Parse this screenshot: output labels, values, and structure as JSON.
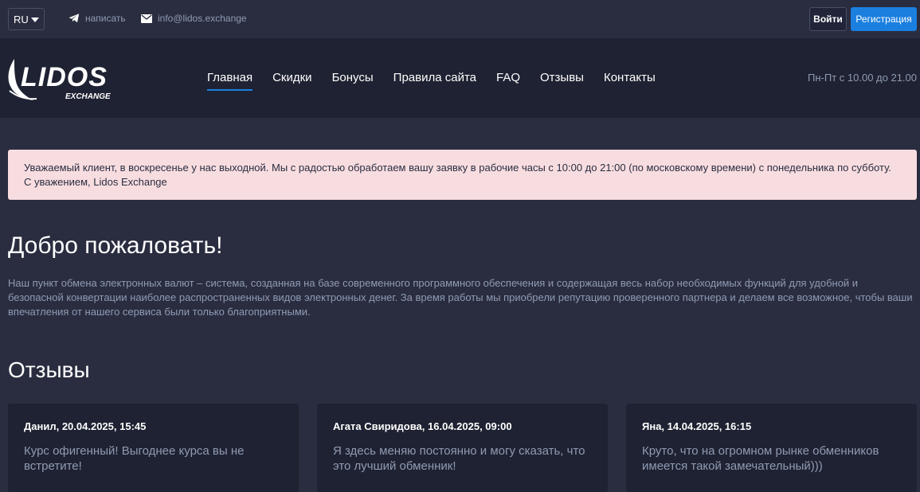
{
  "topbar": {
    "language": "RU",
    "telegram_label": "написать",
    "email_label": "info@lidos.exchange",
    "login_label": "Войти",
    "register_label": "Регистрация"
  },
  "header": {
    "logo_text": "LIDOS",
    "logo_subtext": "EXCHANGE",
    "nav": [
      {
        "label": "Главная",
        "active": true
      },
      {
        "label": "Скидки"
      },
      {
        "label": "Бонусы"
      },
      {
        "label": "Правила сайта"
      },
      {
        "label": "FAQ"
      },
      {
        "label": "Отзывы"
      },
      {
        "label": "Контакты"
      }
    ],
    "hours": "Пн-Пт с 10.00 до 21.00"
  },
  "alert": {
    "text": "Уважаемый клиент, в воскресенье у нас выходной. Мы с радостью обработаем вашу заявку в рабочие часы с 10:00 до 21:00 (по московскому времени) с понедельника по субботу. С уважением, Lidos Exchange"
  },
  "welcome": {
    "title": "Добро пожаловать!",
    "text": "Наш пункт обмена электронных валют – система, созданная на базе современного программного обеспечения и содержащая весь набор необходимых функций для удобной и безопасной конвертации наиболее распространенных видов электронных денег. За время работы мы приобрели репутацию проверенного партнера и делаем все возможное, чтобы ваши впечатления от нашего сервиса были только благоприятными."
  },
  "reviews": {
    "title": "Отзывы",
    "items": [
      {
        "author": "Данил, 20.04.2025, 15:45",
        "text": "Курс офигенный! Выгоднее курса вы не встретите!"
      },
      {
        "author": "Агата Свиридова, 16.04.2025, 09:00",
        "text": "Я здесь меняю постоянно и могу сказать, что это лучший обменник!"
      },
      {
        "author": "Яна, 14.04.2025, 16:15",
        "text": "Круто, что на огромном рынке обменников имеется такой замечательный)))"
      }
    ]
  },
  "colors": {
    "background": "#2a2d40",
    "header": "#1f2232",
    "accent": "#1b7fe0",
    "muted_text": "#8f9bb3",
    "alert_bg": "#f8dde0"
  },
  "icons": {
    "telegram": "telegram-icon",
    "email": "mail-icon",
    "dropdown": "chevron-down-icon"
  }
}
